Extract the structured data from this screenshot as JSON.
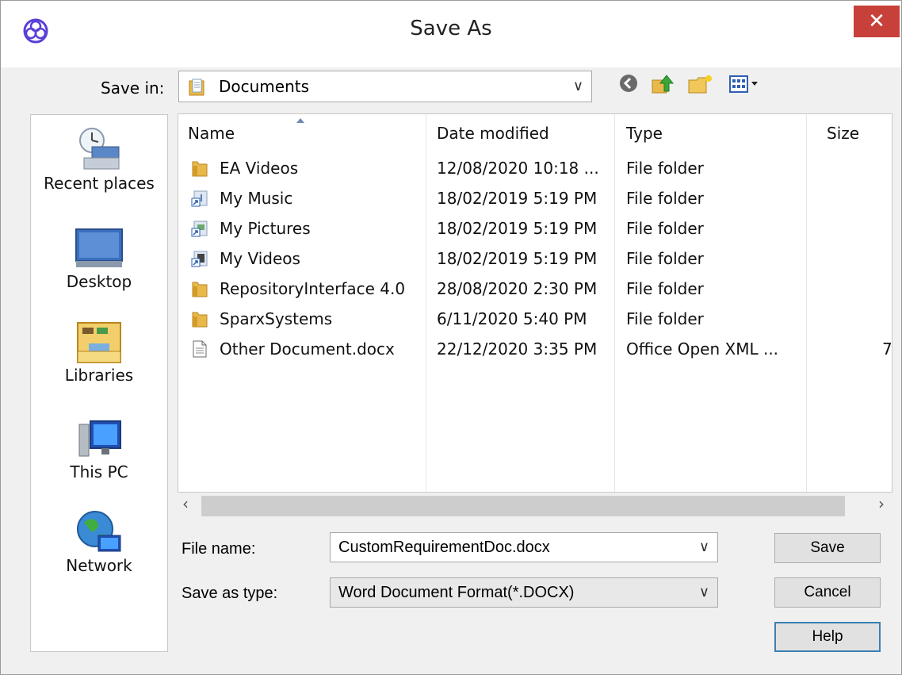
{
  "window": {
    "title": "Save As",
    "close_label": "✕"
  },
  "save_in": {
    "label": "Save in:",
    "value": "Documents",
    "arrow": "∨"
  },
  "toolbar": {
    "icons": [
      "back-icon",
      "up-folder-icon",
      "new-folder-icon",
      "view-menu-icon"
    ]
  },
  "places": [
    {
      "label": "Recent places",
      "icon": "recent-places-icon"
    },
    {
      "label": "Desktop",
      "icon": "desktop-icon"
    },
    {
      "label": "Libraries",
      "icon": "libraries-icon"
    },
    {
      "label": "This PC",
      "icon": "this-pc-icon"
    },
    {
      "label": "Network",
      "icon": "network-icon"
    }
  ],
  "columns": {
    "name": "Name",
    "date": "Date modified",
    "type": "Type",
    "size": "Size"
  },
  "files": [
    {
      "name": "EA Videos",
      "date": "12/08/2020 10:18 ...",
      "type": "File folder",
      "size": "",
      "icon": "folder-icon"
    },
    {
      "name": "My Music",
      "date": "18/02/2019 5:19 PM",
      "type": "File folder",
      "size": "",
      "icon": "music-shortcut-icon"
    },
    {
      "name": "My Pictures",
      "date": "18/02/2019 5:19 PM",
      "type": "File folder",
      "size": "",
      "icon": "pictures-shortcut-icon"
    },
    {
      "name": "My Videos",
      "date": "18/02/2019 5:19 PM",
      "type": "File folder",
      "size": "",
      "icon": "videos-shortcut-icon"
    },
    {
      "name": "RepositoryInterface 4.0",
      "date": "28/08/2020 2:30 PM",
      "type": "File folder",
      "size": "",
      "icon": "folder-icon"
    },
    {
      "name": "SparxSystems",
      "date": "6/11/2020 5:40 PM",
      "type": "File folder",
      "size": "",
      "icon": "folder-icon"
    },
    {
      "name": "Other Document.docx",
      "date": "22/12/2020 3:35 PM",
      "type": "Office Open XML ...",
      "size": "7",
      "icon": "document-icon"
    }
  ],
  "scroll": {
    "left": "‹",
    "right": "›"
  },
  "file_name": {
    "label": "File name:",
    "value": "CustomRequirementDoc.docx",
    "arrow": "∨"
  },
  "save_type": {
    "label": "Save as type:",
    "value": "Word Document Format(*.DOCX)",
    "arrow": "∨"
  },
  "buttons": {
    "save": "Save",
    "cancel": "Cancel",
    "help": "Help"
  },
  "colors": {
    "close": "#c7413a",
    "folder": "#e8b84a",
    "accent": "#3c7fb1"
  }
}
